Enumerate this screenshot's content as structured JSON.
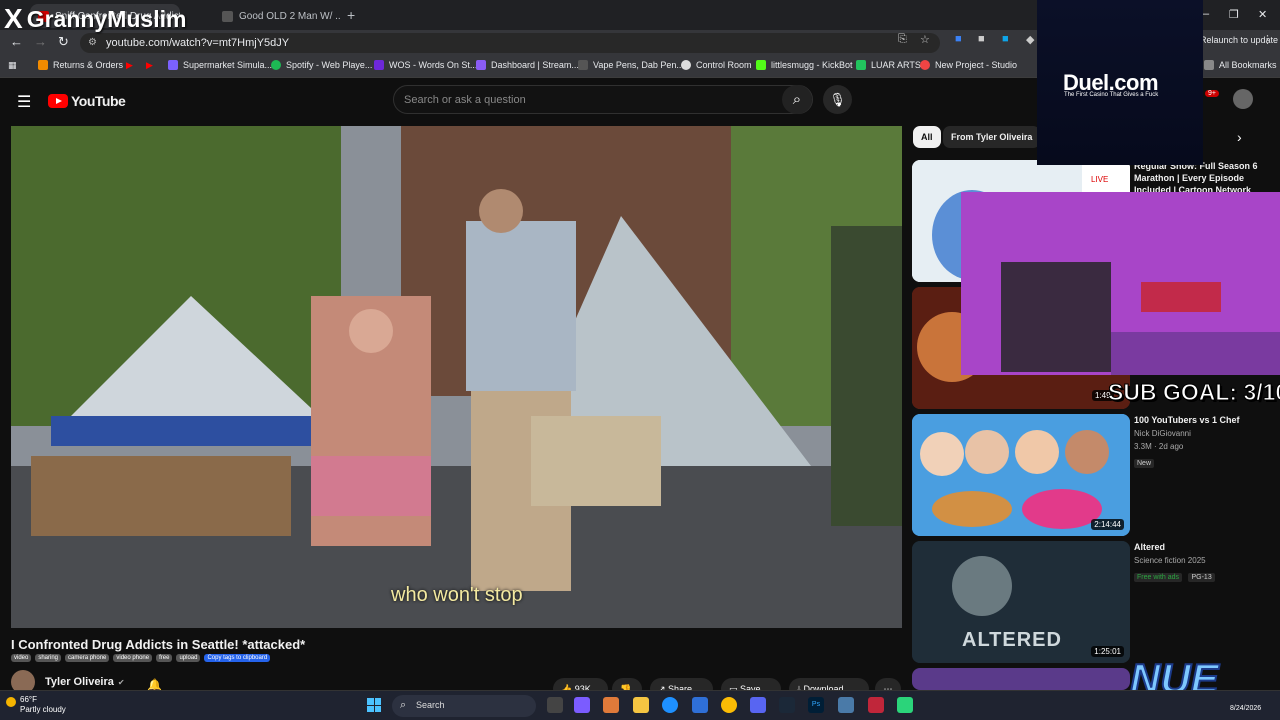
{
  "browser": {
    "tabs": [
      {
        "label": "Sniff Confronted Drug Addicts"
      },
      {
        "label": "Good OLD 2 Man W/ ..."
      }
    ],
    "new_tab": "+",
    "window": {
      "minimize": "–",
      "maximize": "❐",
      "close": "✕"
    },
    "url": "youtube.com/watch?v=mt7HmjY5dJY",
    "relaunch": "Relaunch to update",
    "bookmarks": [
      {
        "label": "Returns & Orders",
        "color": "#f28b00"
      },
      {
        "label": "Supermarket Simula...",
        "color": "#7b61ff"
      },
      {
        "label": "Spotify - Web Playe...",
        "color": "#1db954"
      },
      {
        "label": "WOS - Words On St...",
        "color": "#6d28d9"
      },
      {
        "label": "Dashboard | Stream...",
        "color": "#8b5cf6"
      },
      {
        "label": "Vape Pens, Dab Pen...",
        "color": "#555555"
      },
      {
        "label": "Control Room",
        "color": "#dddddd"
      },
      {
        "label": "littlesmugg - KickBot",
        "color": "#53fc18"
      },
      {
        "label": "LUAR ARTS",
        "color": "#22c55e"
      },
      {
        "label": "New Project - Studio",
        "color": "#ef4444"
      },
      {
        "label": "All Bookmarks",
        "color": "#888888"
      }
    ]
  },
  "youtube": {
    "logo": "YouTube",
    "search_placeholder": "Search or ask a question",
    "notif_count": "9+",
    "caption": "who won't stop",
    "video_title": "I Confronted Drug Addicts in Seattle! *attacked*",
    "tags": [
      "video",
      "sharing",
      "camera phone",
      "video phone",
      "free",
      "upload"
    ],
    "copy_tags": "Copy tags to clipboard",
    "channel": "Tyler Oliveira",
    "actions": {
      "likes": "93K",
      "share": "Share",
      "save": "Save",
      "download": "Download"
    },
    "chips": {
      "all": "All",
      "from": "From Tyler Oliveira"
    },
    "recommendations": [
      {
        "title": "Regular Show: Full Season 6 Marathon | Every Episode Included | Cartoon Network",
        "live": "LIVE",
        "duration": ""
      },
      {
        "title": "",
        "duration": "1:49"
      },
      {
        "title": "100 YouTubers vs 1 Chef",
        "channel": "Nick DiGiovanni",
        "meta": "3.3M · 2d ago",
        "badges": [
          "New"
        ],
        "duration": "2:14:44"
      },
      {
        "title": "Altered",
        "channel": "Science fiction 2025",
        "badges": [
          "Free with ads",
          "PG-13"
        ],
        "overlay": "ALTERED",
        "duration": "1:25:01"
      }
    ]
  },
  "overlays": {
    "streamer": "GrannyMuslim",
    "duel_name": "Duel.com",
    "duel_tagline": "The First Casino That Gives a Fuck",
    "sub_goal": "SUB GOAL: 3/10",
    "nue": "NUE"
  },
  "taskbar": {
    "temp": "66°F",
    "weather": "Partly cloudy",
    "search": "Search",
    "date": "8/24/2026"
  }
}
